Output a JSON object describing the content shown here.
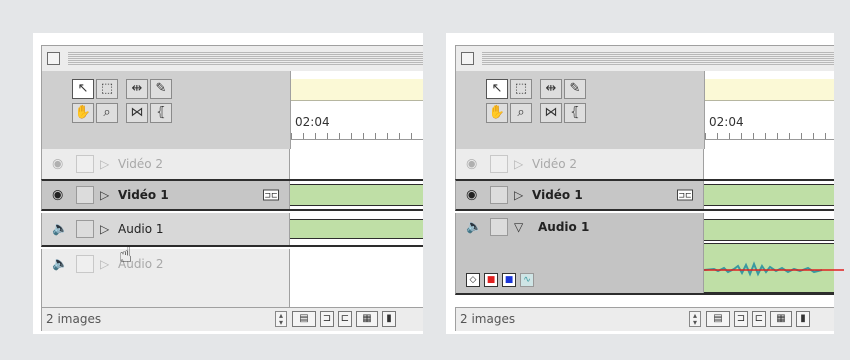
{
  "panels": [
    {
      "ruler_time": "02:04",
      "tracks": [
        {
          "label": "Vidéo 2",
          "state": "dim"
        },
        {
          "label": "Vidéo 1",
          "state": "selected"
        },
        {
          "label": "Audio 1",
          "state": "normal"
        },
        {
          "label": "Audio 2",
          "state": "dim"
        }
      ],
      "status_text": "2 images"
    },
    {
      "ruler_time": "02:04",
      "tracks": [
        {
          "label": "Vidéo 2",
          "state": "dim"
        },
        {
          "label": "Vidéo 1",
          "state": "selected"
        },
        {
          "label": "Audio 1",
          "state": "expanded"
        }
      ],
      "status_text": "2 images"
    }
  ],
  "colors": {
    "clip_green": "#bfdfa6",
    "ruler_yellow": "#fbf9d6",
    "waveform_teal": "#3a9aa0",
    "volume_red": "#e02020"
  },
  "icons": {
    "tools": [
      "arrow-icon",
      "range-select-icon",
      "track-select-icon",
      "razor-icon",
      "hand-icon",
      "zoom-icon",
      "link-icon",
      "fade-icon"
    ],
    "track": [
      "eye-icon",
      "speaker-icon",
      "lock-box",
      "expand-triangle-icon",
      "fx-icon"
    ],
    "cursor": "hand-cursor-icon"
  }
}
